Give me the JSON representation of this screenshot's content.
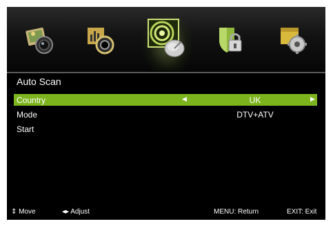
{
  "menu": {
    "icons": [
      {
        "name": "picture-icon",
        "selected": false
      },
      {
        "name": "sound-icon",
        "selected": false
      },
      {
        "name": "channel-icon",
        "selected": true
      },
      {
        "name": "lock-icon",
        "selected": false
      },
      {
        "name": "setup-icon",
        "selected": false
      }
    ]
  },
  "panel": {
    "title": "Auto Scan",
    "rows": [
      {
        "label": "Country",
        "value": "UK",
        "highlighted": true
      },
      {
        "label": "Mode",
        "value": "DTV+ATV",
        "highlighted": false
      },
      {
        "label": "Start",
        "value": "",
        "highlighted": false
      }
    ]
  },
  "footer": {
    "move": "⇕ Move",
    "adjust": "◂▸ Adjust",
    "menu": "MENU: Return",
    "exit": "EXIT: Exit"
  },
  "colors": {
    "highlight": "#7cb41e",
    "background": "#000000",
    "text": "#ffffff"
  }
}
